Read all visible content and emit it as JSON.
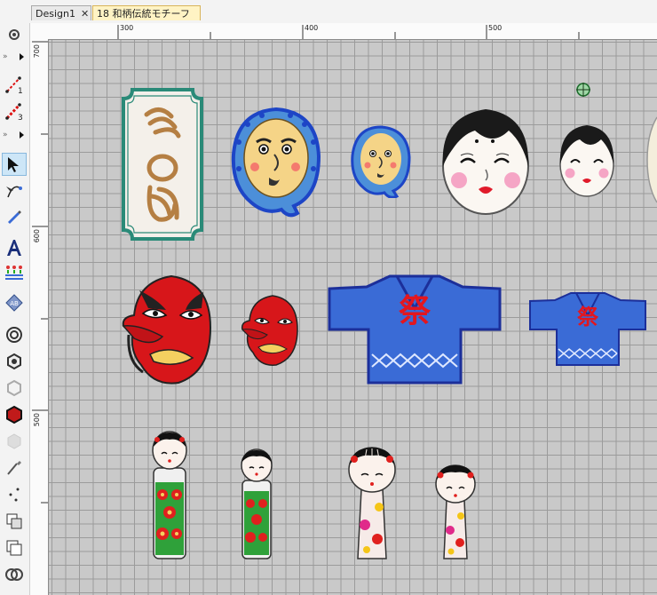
{
  "tabs": [
    {
      "label": "Design1",
      "close": "✕",
      "active": false
    },
    {
      "label": "18 和柄伝統モチーフ",
      "close": "✕",
      "active": true
    }
  ],
  "rulers": {
    "top": [
      "300",
      "400",
      "500"
    ],
    "left": [
      "700",
      "600",
      "500"
    ]
  },
  "toolbar": {
    "tool_labels": [
      "1",
      "3"
    ],
    "expand_glyph": "»"
  },
  "motifs": {
    "noren_text": "へのへのもへじ",
    "happi_kanji": "祭"
  },
  "colors": {
    "tab_active": "#fff3c4",
    "canvas_bg": "#c9c9c9",
    "grid": "#9b9b9b",
    "accent_blue": "#3a6bd6"
  }
}
